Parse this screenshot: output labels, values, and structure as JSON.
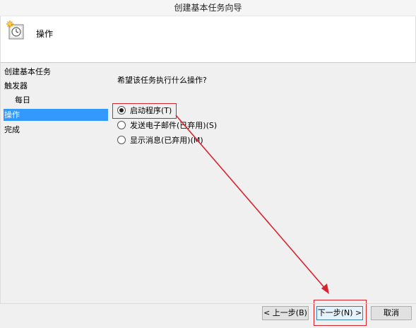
{
  "window": {
    "title": "创建基本任务向导"
  },
  "header": {
    "title": "操作",
    "icon": "task-clock-icon"
  },
  "steps": [
    {
      "label": "创建基本任务",
      "level": 0,
      "active": false
    },
    {
      "label": "触发器",
      "level": 0,
      "active": false
    },
    {
      "label": "每日",
      "level": 1,
      "active": false
    },
    {
      "label": "操作",
      "level": 0,
      "active": true
    },
    {
      "label": "完成",
      "level": 0,
      "active": false
    }
  ],
  "main": {
    "question": "希望该任务执行什么操作?",
    "options": [
      {
        "label": "启动程序(T)",
        "checked": true
      },
      {
        "label": "发送电子邮件(已弃用)(S)",
        "checked": false
      },
      {
        "label": "显示消息(已弃用)(M)",
        "checked": false
      }
    ]
  },
  "buttons": {
    "back": "< 上一步(B)",
    "next": "下一步(N) >",
    "cancel": "取消"
  },
  "colors": {
    "selection": "#3399ff",
    "annotation": "#d9232e"
  }
}
